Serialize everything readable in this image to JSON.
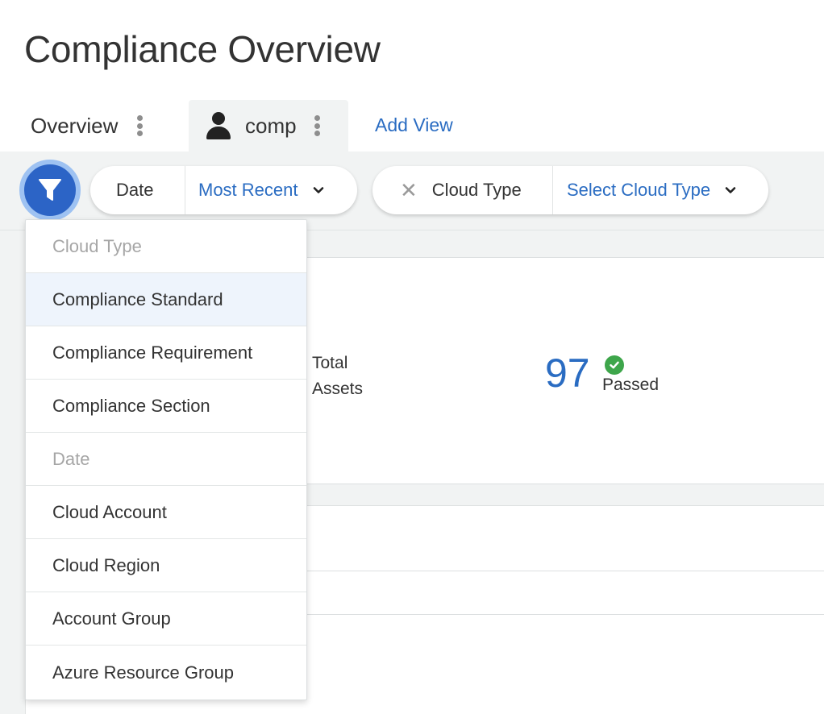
{
  "page": {
    "title": "Compliance Overview"
  },
  "tabs": [
    {
      "label": "Overview"
    },
    {
      "label": "comp"
    }
  ],
  "add_view_label": "Add View",
  "filters": {
    "date": {
      "label": "Date",
      "value": "Most Recent"
    },
    "cloud_type": {
      "label": "Cloud Type",
      "value": "Select Cloud Type"
    }
  },
  "stats": {
    "total_assets_label": "Total\nAssets",
    "passed_value": "97",
    "passed_label": "Passed"
  },
  "dropdown": {
    "items": [
      {
        "label": "Cloud Type",
        "disabled": true
      },
      {
        "label": "Compliance Standard"
      },
      {
        "label": "Compliance Requirement"
      },
      {
        "label": "Compliance Section"
      },
      {
        "label": "Date",
        "disabled": true
      },
      {
        "label": "Cloud Account"
      },
      {
        "label": "Cloud Region"
      },
      {
        "label": "Account Group"
      },
      {
        "label": "Azure Resource Group"
      }
    ]
  },
  "icons": {
    "filter": "filter-icon",
    "user": "user-icon",
    "menu": "kebab-menu-icon",
    "chevron": "chevron-down-icon",
    "remove": "close-icon",
    "status": "check-circle-icon"
  },
  "colors": {
    "accent": "#2a6cc2",
    "filter_button": "#2c64c6",
    "passed": "#3ea64b",
    "background_band": "#f1f3f3"
  }
}
